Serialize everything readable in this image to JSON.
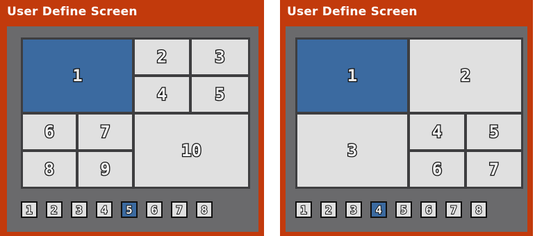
{
  "colors": {
    "frame": "#c23a0c",
    "inner": "#6a6a6c",
    "cell": "#e0e0e0",
    "selected": "#3b6aa0",
    "grid_line": "#3e3e40"
  },
  "left_panel": {
    "title": "User Define Screen",
    "cells": [
      "1",
      "2",
      "3",
      "4",
      "5",
      "6",
      "7",
      "8",
      "9",
      "10"
    ],
    "selected_cell": "1",
    "layout_buttons": [
      "1",
      "2",
      "3",
      "4",
      "5",
      "6",
      "7",
      "8"
    ],
    "selected_button": "5"
  },
  "right_panel": {
    "title": "User Define Screen",
    "cells": [
      "1",
      "2",
      "3",
      "4",
      "5",
      "6",
      "7"
    ],
    "selected_cell": "1",
    "layout_buttons": [
      "1",
      "2",
      "3",
      "4",
      "5",
      "6",
      "7",
      "8"
    ],
    "selected_button": "4"
  }
}
